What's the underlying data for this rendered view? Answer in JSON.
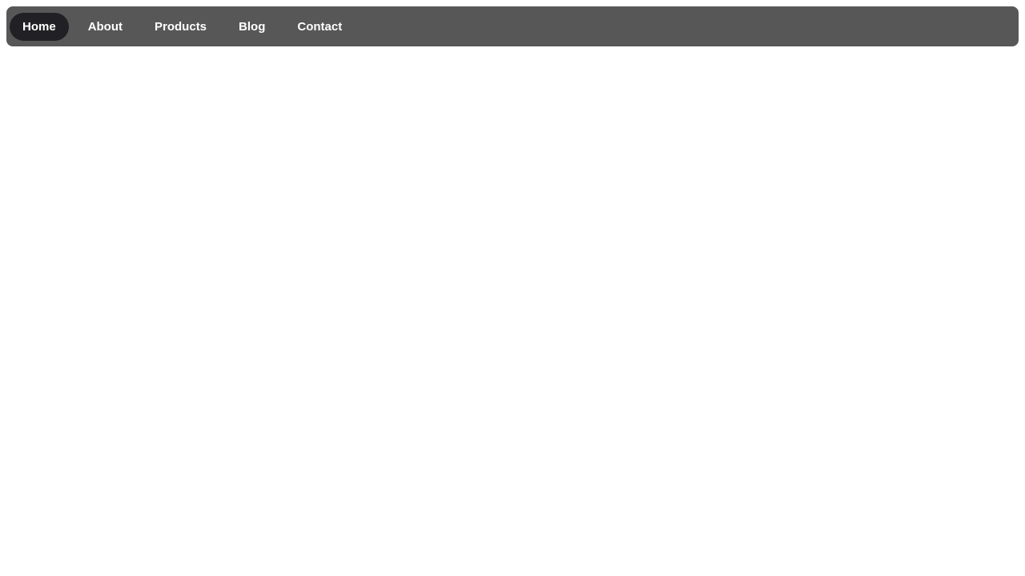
{
  "nav": {
    "items": [
      {
        "label": "Home",
        "active": true
      },
      {
        "label": "About",
        "active": false
      },
      {
        "label": "Products",
        "active": false
      },
      {
        "label": "Blog",
        "active": false
      },
      {
        "label": "Contact",
        "active": false
      }
    ]
  },
  "colors": {
    "navbar_bg": "#575757",
    "active_bg": "#212024",
    "text": "#ffffff",
    "page_bg": "#ffffff"
  }
}
